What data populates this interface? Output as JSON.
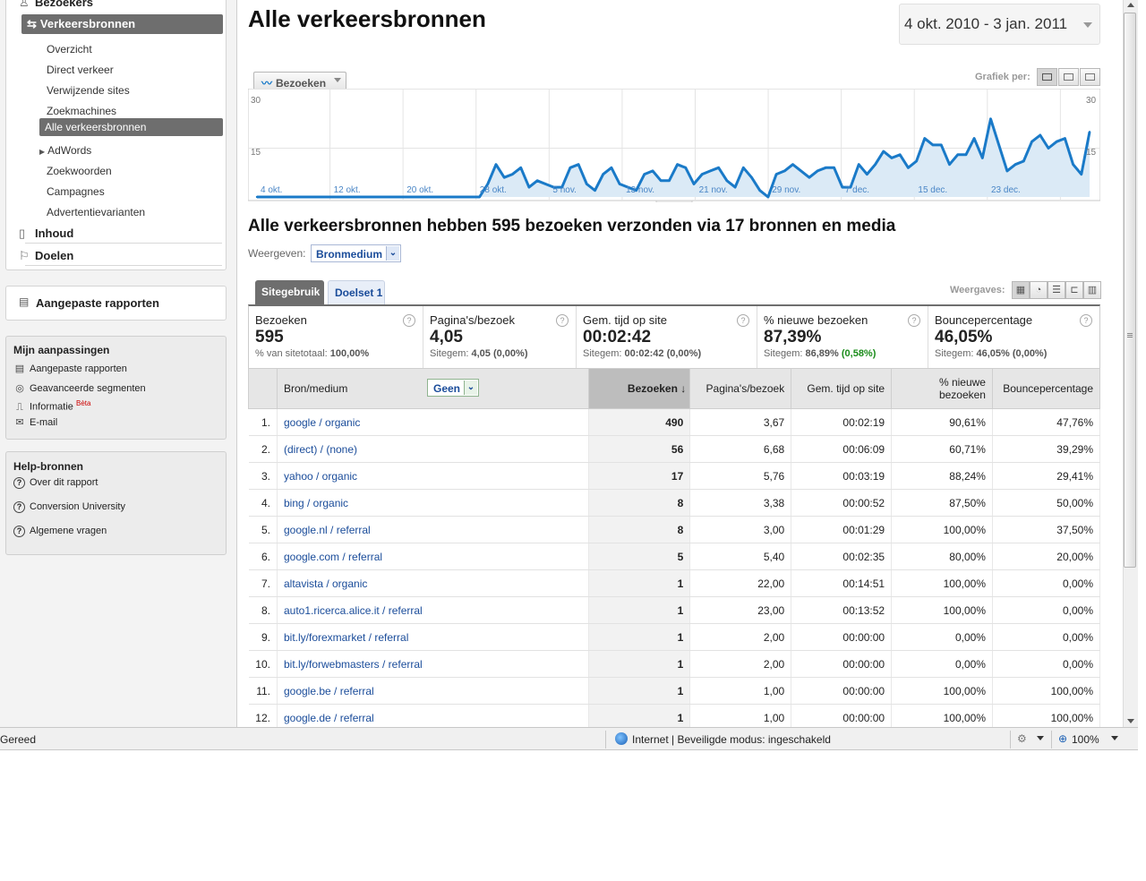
{
  "sidebar": {
    "bezoekers": "Bezoekers",
    "verkeersbronnen": "Verkeersbronnen",
    "sub": [
      "Overzicht",
      "Direct verkeer",
      "Verwijzende sites",
      "Zoekmachines"
    ],
    "active_sub": "Alle verkeersbronnen",
    "adwords": "AdWords",
    "sub2": [
      "Zoekwoorden",
      "Campagnes",
      "Advertentievarianten"
    ],
    "inhoud": "Inhoud",
    "doelen": "Doelen",
    "custom_reports": "Aangepaste rapporten",
    "mijn": {
      "title": "Mijn aanpassingen",
      "items": [
        "Aangepaste rapporten",
        "Geavanceerde segmenten",
        "Informatie",
        "E-mail"
      ],
      "beta": "Bèta"
    },
    "help": {
      "title": "Help-bronnen",
      "items": [
        "Over dit rapport",
        "Conversion University",
        "Algemene vragen"
      ]
    }
  },
  "page": {
    "title": "Alle verkeersbronnen",
    "daterange": "4 okt. 2010 - 3 jan. 2011",
    "metric_button": "Bezoeken",
    "grafiek_label": "Grafiek per:",
    "summary": "Alle verkeersbronnen hebben 595 bezoeken verzonden via 17 bronnen en media",
    "weergeven_label": "Weergeven:",
    "weergeven_value": "Bronmedium",
    "tabs": [
      "Sitegebruik",
      "Doelset 1"
    ],
    "weergaves_label": "Weergaves:"
  },
  "chart_data": {
    "type": "area",
    "ylim": [
      0,
      30
    ],
    "yticks": [
      "30",
      "15",
      "30",
      "15"
    ],
    "x_tick_labels": [
      "4 okt.",
      "12 okt.",
      "20 okt.",
      "28 okt.",
      "5 nov.",
      "13 nov.",
      "21 nov.",
      "29 nov.",
      "7 dec.",
      "15 dec.",
      "23 dec."
    ],
    "series": [
      {
        "values": [
          0,
          0,
          0,
          0,
          0,
          0,
          0,
          0,
          0,
          0,
          0,
          0,
          0,
          0,
          0,
          0,
          0,
          0,
          0,
          0,
          0,
          0,
          0,
          0,
          0,
          0,
          0,
          0,
          4,
          10,
          6,
          7,
          9,
          3,
          5,
          4,
          3,
          3,
          9,
          10,
          4,
          2,
          7,
          9,
          4,
          3,
          2,
          7,
          8,
          5,
          5,
          10,
          9,
          4,
          7,
          8,
          9,
          5,
          3,
          9,
          6,
          2,
          0,
          7,
          8,
          10,
          8,
          6,
          8,
          9,
          9,
          3,
          3,
          10,
          7,
          10,
          14,
          12,
          13,
          9,
          11,
          18,
          16,
          16,
          10,
          13,
          13,
          18,
          12,
          24,
          16,
          8,
          10,
          11,
          17,
          19,
          15,
          17,
          18,
          10,
          7,
          20
        ]
      }
    ]
  },
  "scorecard": [
    {
      "label": "Bezoeken",
      "value": "595",
      "sub_label": "% van sitetotaal:",
      "sub_value": "100,00%",
      "sub_extra": ""
    },
    {
      "label": "Pagina's/bezoek",
      "value": "4,05",
      "sub_label": "Sitegem:",
      "sub_value": "4,05",
      "sub_extra": "(0,00%)"
    },
    {
      "label": "Gem. tijd op site",
      "value": "00:02:42",
      "sub_label": "Sitegem:",
      "sub_value": "00:02:42",
      "sub_extra": "(0,00%)"
    },
    {
      "label": "% nieuwe bezoeken",
      "value": "87,39%",
      "sub_label": "Sitegem:",
      "sub_value": "86,89%",
      "sub_extra": "(0,58%)"
    },
    {
      "label": "Bouncepercentage",
      "value": "46,05%",
      "sub_label": "Sitegem:",
      "sub_value": "46,05%",
      "sub_extra": "(0,00%)"
    }
  ],
  "table": {
    "headers": [
      "Bron/medium",
      "Bezoeken",
      "Pagina's/bezoek",
      "Gem. tijd op site",
      "% nieuwe bezoeken",
      "Bouncepercentage"
    ],
    "secondary_dim": "Geen",
    "rows": [
      [
        "1.",
        "google / organic",
        "490",
        "3,67",
        "00:02:19",
        "90,61%",
        "47,76%"
      ],
      [
        "2.",
        "(direct) / (none)",
        "56",
        "6,68",
        "00:06:09",
        "60,71%",
        "39,29%"
      ],
      [
        "3.",
        "yahoo / organic",
        "17",
        "5,76",
        "00:03:19",
        "88,24%",
        "29,41%"
      ],
      [
        "4.",
        "bing / organic",
        "8",
        "3,38",
        "00:00:52",
        "87,50%",
        "50,00%"
      ],
      [
        "5.",
        "google.nl / referral",
        "8",
        "3,00",
        "00:01:29",
        "100,00%",
        "37,50%"
      ],
      [
        "6.",
        "google.com / referral",
        "5",
        "5,40",
        "00:02:35",
        "80,00%",
        "20,00%"
      ],
      [
        "7.",
        "altavista / organic",
        "1",
        "22,00",
        "00:14:51",
        "100,00%",
        "0,00%"
      ],
      [
        "8.",
        "auto1.ricerca.alice.it / referral",
        "1",
        "23,00",
        "00:13:52",
        "100,00%",
        "0,00%"
      ],
      [
        "9.",
        "bit.ly/forexmarket / referral",
        "1",
        "2,00",
        "00:00:00",
        "0,00%",
        "0,00%"
      ],
      [
        "10.",
        "bit.ly/forwebmasters / referral",
        "1",
        "2,00",
        "00:00:00",
        "0,00%",
        "0,00%"
      ],
      [
        "11.",
        "google.be / referral",
        "1",
        "1,00",
        "00:00:00",
        "100,00%",
        "100,00%"
      ],
      [
        "12.",
        "google.de / referral",
        "1",
        "1,00",
        "00:00:00",
        "100,00%",
        "100,00%"
      ]
    ]
  },
  "statusbar": {
    "left": "Gereed",
    "zone": "Internet | Beveiligde modus: ingeschakeld",
    "zoom": "100%"
  },
  "colors": {
    "accent": "#1a7ac8",
    "fill": "#dbeaf6",
    "active": "#6e6e6e",
    "green": "#1a8c1a"
  }
}
